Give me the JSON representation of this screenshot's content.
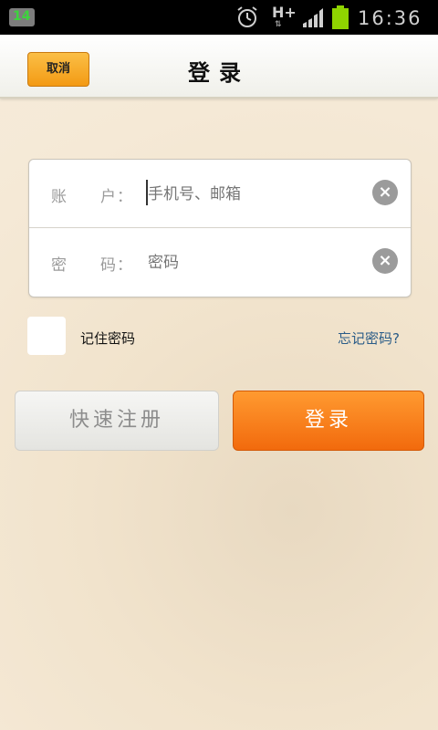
{
  "status_bar": {
    "notification_count": "14",
    "network_type": "H+",
    "network_arrows": "⇅",
    "time": "16:36"
  },
  "header": {
    "cancel_label": "取消",
    "title": "登录"
  },
  "form": {
    "account": {
      "label": "账　　户：",
      "placeholder": "手机号、邮箱",
      "value": ""
    },
    "password": {
      "label": "密　　码：",
      "placeholder": "密码",
      "value": ""
    },
    "clear_icon": "×"
  },
  "options": {
    "remember_label": "记住密码",
    "remember_checked": false,
    "forgot_label": "忘记密码?"
  },
  "actions": {
    "register_label": "快速注册",
    "login_label": "登录"
  },
  "colors": {
    "accent_orange": "#f39a14",
    "login_orange": "#f26a0d",
    "background": "#f3e6d0",
    "link_blue": "#2a5c88"
  }
}
